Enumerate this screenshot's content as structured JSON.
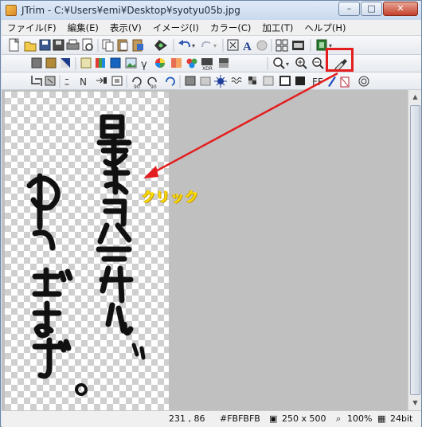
{
  "window": {
    "title": "JTrim - C:¥Users¥emi¥Desktop¥syotyu05b.jpg",
    "controls": {
      "minimize": "–",
      "maximize": "□",
      "close": "✕"
    }
  },
  "menu": [
    {
      "label": "ファイル(F)"
    },
    {
      "label": "編集(E)"
    },
    {
      "label": "表示(V)"
    },
    {
      "label": "イメージ(I)"
    },
    {
      "label": "カラー(C)"
    },
    {
      "label": "加工(T)"
    },
    {
      "label": "ヘルプ(H)"
    }
  ],
  "annotation": {
    "label": "クリック",
    "color": "#e41e1e",
    "label_color": "#ffe100"
  },
  "status": {
    "coords": "231 , 86",
    "color": "#FBFBFB",
    "size": "250 x 500",
    "zoom": "100%",
    "depth": "24bit"
  },
  "canvas": {
    "background": "#c0c0c0",
    "transparency": "checkerboard"
  },
  "toolbar_icons": [
    "new-icon",
    "open-icon",
    "save-icon",
    "print-icon",
    "preview-icon",
    "copy-icon",
    "paste-icon",
    "paste-new-icon",
    "capture-icon",
    "undo-icon",
    "redo-icon",
    "fit-icon",
    "text-icon",
    "circle-icon",
    "grid-icon",
    "film-icon",
    "palette-icon",
    "zoom-in-icon",
    "zoom-in-plus-icon",
    "zoom-out-icon",
    "eyedropper-icon"
  ]
}
